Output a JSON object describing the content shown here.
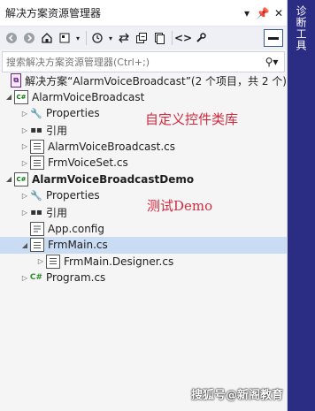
{
  "panel": {
    "title": "解决方案资源管理器",
    "title_buttons": [
      "▾",
      "ᛘ",
      "✕"
    ]
  },
  "toolbar": {
    "icons": [
      "back-icon",
      "forward-icon",
      "home-icon",
      "switch-views-icon",
      "history-icon",
      "sync-icon",
      "collapse-all-icon",
      "show-all-files-icon",
      "code-view-icon",
      "properties-icon",
      "auto-hide-icon"
    ]
  },
  "search": {
    "placeholder": "搜索解决方案资源管理器(Ctrl+;)"
  },
  "tree": {
    "solution": "解决方案“AlarmVoiceBroadcast”(2 个项目，共 2 个)",
    "project1": {
      "name": "AlarmVoiceBroadcast",
      "items": [
        "Properties",
        "引用",
        "AlarmVoiceBroadcast.cs",
        "FrmVoiceSet.cs"
      ]
    },
    "project2": {
      "name": "AlarmVoiceBroadcastDemo",
      "items": [
        "Properties",
        "引用",
        "App.config",
        "FrmMain.cs",
        "FrmMain.Designer.cs",
        "Program.cs"
      ]
    }
  },
  "annotations": {
    "lib": "自定义控件类库",
    "demo": "测试Demo"
  },
  "sidebar": {
    "label": "诊断工具"
  },
  "watermark": "搜狐号@新阁教育",
  "colors": {
    "selection": "#c9dcf3",
    "annotation": "#d6293e",
    "sidebar": "#2b2d85"
  }
}
